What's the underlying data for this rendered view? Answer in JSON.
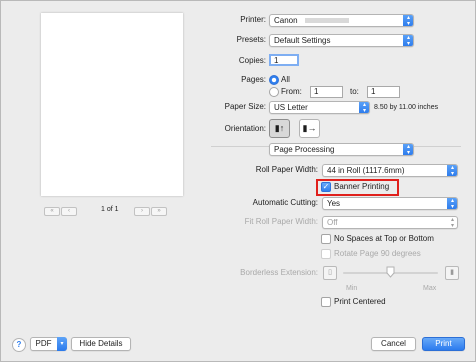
{
  "preview": {
    "page_label": "1 of 1",
    "first": "«",
    "prev": "‹",
    "next": "›",
    "last": "»"
  },
  "printer": {
    "label": "Printer:",
    "value": "Canon"
  },
  "presets": {
    "label": "Presets:",
    "value": "Default Settings"
  },
  "copies": {
    "label": "Copies:",
    "value": "1"
  },
  "pages": {
    "label": "Pages:",
    "all": "All",
    "from_label": "From:",
    "from_value": "1",
    "to_label": "to:",
    "to_value": "1"
  },
  "paper_size": {
    "label": "Paper Size:",
    "value": "US Letter",
    "info": "8.50 by 11.00 inches"
  },
  "orientation": {
    "label": "Orientation:"
  },
  "section": {
    "value": "Page Processing"
  },
  "roll_paper_width": {
    "label": "Roll Paper Width:",
    "value": "44 in Roll (1117.6mm)"
  },
  "banner_printing": {
    "label": "Banner Printing",
    "checked": true
  },
  "automatic_cutting": {
    "label": "Automatic Cutting:",
    "value": "Yes"
  },
  "fit_roll_paper_width": {
    "label": "Fit Roll Paper Width:",
    "value": "Off"
  },
  "no_spaces": {
    "label": "No Spaces at Top or Bottom"
  },
  "rotate_page": {
    "label": "Rotate Page 90 degrees"
  },
  "borderless_extension": {
    "label": "Borderless Extension:",
    "min": "Min",
    "max": "Max",
    "level": 0.5
  },
  "print_centered": {
    "label": "Print Centered"
  },
  "footer": {
    "help": "?",
    "pdf": "PDF",
    "hide_details": "Hide Details",
    "cancel": "Cancel",
    "print": "Print"
  },
  "icons": {
    "arrow": "▴▾",
    "portrait": "portrait-orientation-icon",
    "landscape": "landscape-orientation-icon",
    "slider_left": "small-page-icon",
    "slider_right": "large-page-icon"
  },
  "colors": {
    "accent": "#2f7fee",
    "highlight": "#e0201c"
  }
}
